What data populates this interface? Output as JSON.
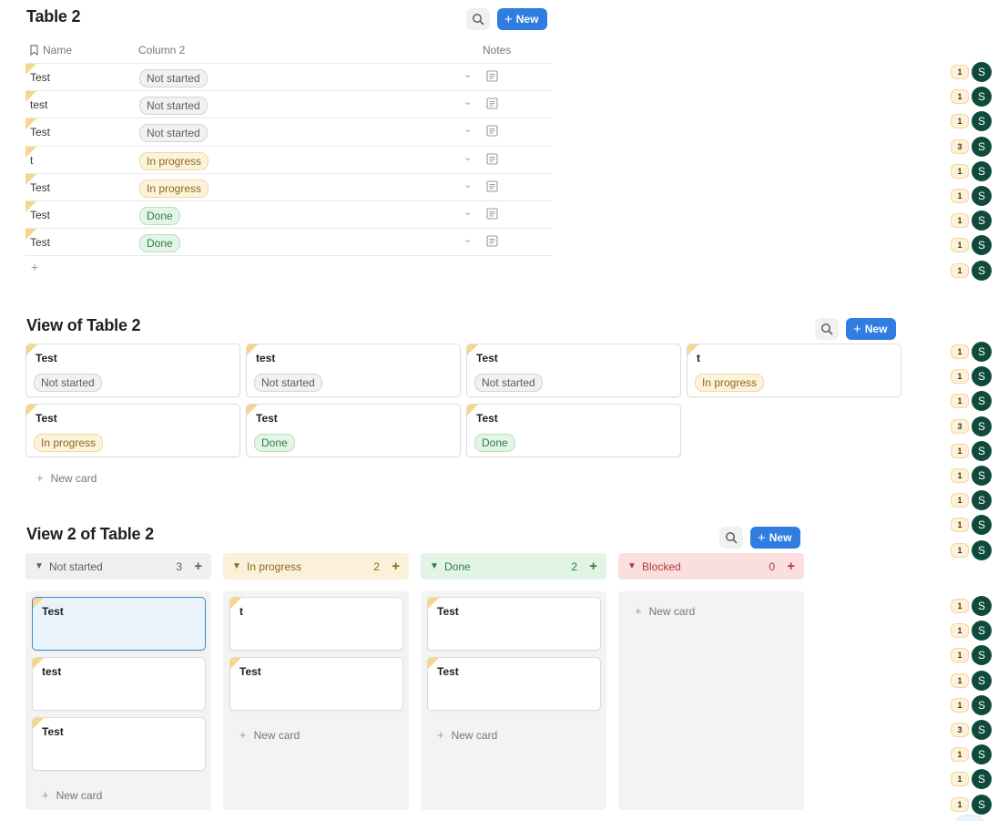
{
  "table_section": {
    "title": "Table 2",
    "new_label": "New",
    "headers": {
      "name": "Name",
      "column2": "Column 2",
      "notes": "Notes"
    },
    "rows": [
      {
        "name": "Test",
        "status": "Not started"
      },
      {
        "name": "test",
        "status": "Not started"
      },
      {
        "name": "Test",
        "status": "Not started"
      },
      {
        "name": "t",
        "status": "In progress"
      },
      {
        "name": "Test",
        "status": "In progress"
      },
      {
        "name": "Test",
        "status": "Done"
      },
      {
        "name": "Test",
        "status": "Done"
      }
    ],
    "add_row": "+"
  },
  "gallery_section": {
    "title": "View of Table 2",
    "new_label": "New",
    "cards": [
      {
        "title": "Test",
        "status": "Not started"
      },
      {
        "title": "test",
        "status": "Not started"
      },
      {
        "title": "Test",
        "status": "Not started"
      },
      {
        "title": "t",
        "status": "In progress"
      },
      {
        "title": "Test",
        "status": "In progress"
      },
      {
        "title": "Test",
        "status": "Done"
      },
      {
        "title": "Test",
        "status": "Done"
      }
    ],
    "new_card_label": "New card"
  },
  "board_section": {
    "title": "View 2 of Table 2",
    "new_label": "New",
    "new_card_label": "New card",
    "columns": [
      {
        "label": "Not started",
        "count": "3",
        "color": "#efefed",
        "text_color": "#5f5e5b",
        "cards": [
          "Test",
          "test",
          "Test"
        ]
      },
      {
        "label": "In progress",
        "count": "2",
        "color": "#fbf0d9",
        "text_color": "#8a6a1a",
        "cards": [
          "t",
          "Test"
        ]
      },
      {
        "label": "Done",
        "count": "2",
        "color": "#e2f4e6",
        "text_color": "#2e7d43",
        "cards": [
          "Test",
          "Test"
        ]
      },
      {
        "label": "Blocked",
        "count": "0",
        "color": "#fbdede",
        "text_color": "#b23b3b",
        "cards": []
      }
    ]
  },
  "comment_rail": {
    "groups": [
      [
        "1",
        "1",
        "1",
        "3",
        "1",
        "1",
        "1",
        "1",
        "1"
      ],
      [
        "1",
        "1",
        "1",
        "3",
        "1",
        "1",
        "1",
        "1",
        "1"
      ],
      [
        "1",
        "1",
        "1",
        "1",
        "1",
        "3",
        "1",
        "1",
        "1"
      ]
    ],
    "avatar_letter": "S"
  },
  "colors": {
    "accent": "#2f7de1",
    "avatar": "#0f4a3a",
    "corner_marker": "#f6d58c"
  }
}
